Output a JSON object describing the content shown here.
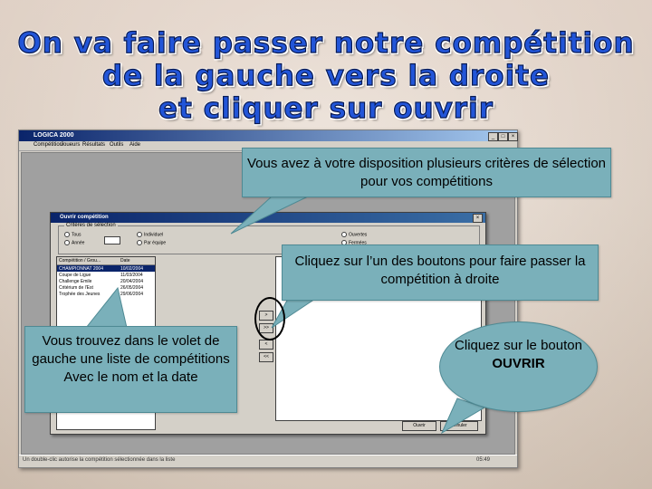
{
  "headline": {
    "line1": "On va faire passer notre compétition",
    "line2": "de la gauche vers la droite",
    "line3": "et cliquer sur ouvrir"
  },
  "app": {
    "title": "LOGICA 2000",
    "menu": [
      "Compétition",
      "Joueurs",
      "Résultats",
      "Outils",
      "Aide"
    ],
    "status_text": "Un double-clic autorise la compétition sélectionnée dans la liste",
    "status_time": "05:49"
  },
  "dialog": {
    "title": "Ouvrir compétition",
    "group_label": "Critères de sélection",
    "radios": [
      "Tous",
      "Année",
      "Individuel",
      "Par équipe",
      "Ouvertes",
      "Fermées"
    ],
    "list_headers": [
      "Compétition / Grou...",
      "Date"
    ],
    "rows": [
      {
        "name": "CHAMPIONNAT 2004",
        "date": "10/02/2004"
      },
      {
        "name": "Coupe de Ligue",
        "date": "11/03/2004"
      },
      {
        "name": "Challenge Emile",
        "date": "20/04/2004"
      },
      {
        "name": "Critérium de l'Est",
        "date": "26/05/2004"
      },
      {
        "name": "Trophée des Jeunes",
        "date": "29/06/2004"
      }
    ],
    "arrows": [
      ">",
      ">>",
      "<",
      "<<"
    ],
    "ok_label": "Ouvrir",
    "cancel_label": "Annuler"
  },
  "callouts": {
    "top": "Vous avez à votre disposition plusieurs critères de sélection pour vos compétitions",
    "mid": "Cliquez sur l’un des boutons pour faire passer la compétition à droite",
    "left": "Vous trouvez dans le volet de gauche une liste de compétitions Avec le nom et la date",
    "ellipse_prefix": "Cliquez sur le bouton",
    "ellipse_bold": "OUVRIR"
  },
  "colors": {
    "callout": "#7ab0ba",
    "title": "#2255d8",
    "windowbar": "#0a246a"
  }
}
